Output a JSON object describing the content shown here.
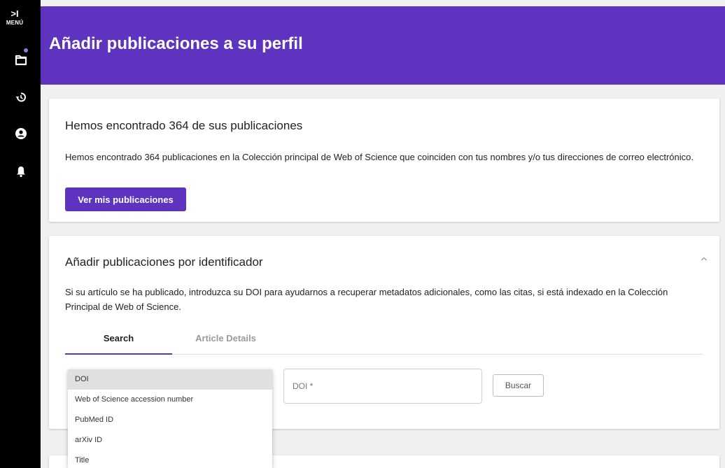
{
  "sidebar": {
    "menu_glyph": ">I",
    "menu_label": "MENÚ",
    "icons": [
      "folder-icon",
      "history-icon",
      "account-icon",
      "bell-icon"
    ]
  },
  "header": {
    "title": "Añadir publicaciones a su perfil"
  },
  "found_card": {
    "title": "Hemos encontrado 364 de sus publicaciones",
    "text": "Hemos encontrado 364 publicaciones en la Colección principal de Web of Science que coinciden con tus nombres y/o tus direcciones de correo electrónico.",
    "button_label": "Ver mis publicaciones"
  },
  "identifier_card": {
    "title": "Añadir publicaciones por identificador",
    "text": "Si su artículo se ha publicado, introduzca su DOI para ayudarnos a recuperar metadatos adicionales, como las citas, si está indexado en la Colección Principal de Web of Science.",
    "tabs": [
      {
        "label": "Search",
        "active": true
      },
      {
        "label": "Article Details",
        "active": false
      }
    ],
    "input_placeholder": "DOI *",
    "search_button": "Buscar"
  },
  "dropdown": {
    "selected": "DOI",
    "options": [
      "DOI",
      "Web of Science accession number",
      "PubMed ID",
      "arXiv ID",
      "Title"
    ]
  },
  "colors": {
    "brand": "#5d33bf",
    "sidebar": "#000000",
    "background": "#f0f0f0",
    "notification_dot": "#8c7bd9"
  }
}
